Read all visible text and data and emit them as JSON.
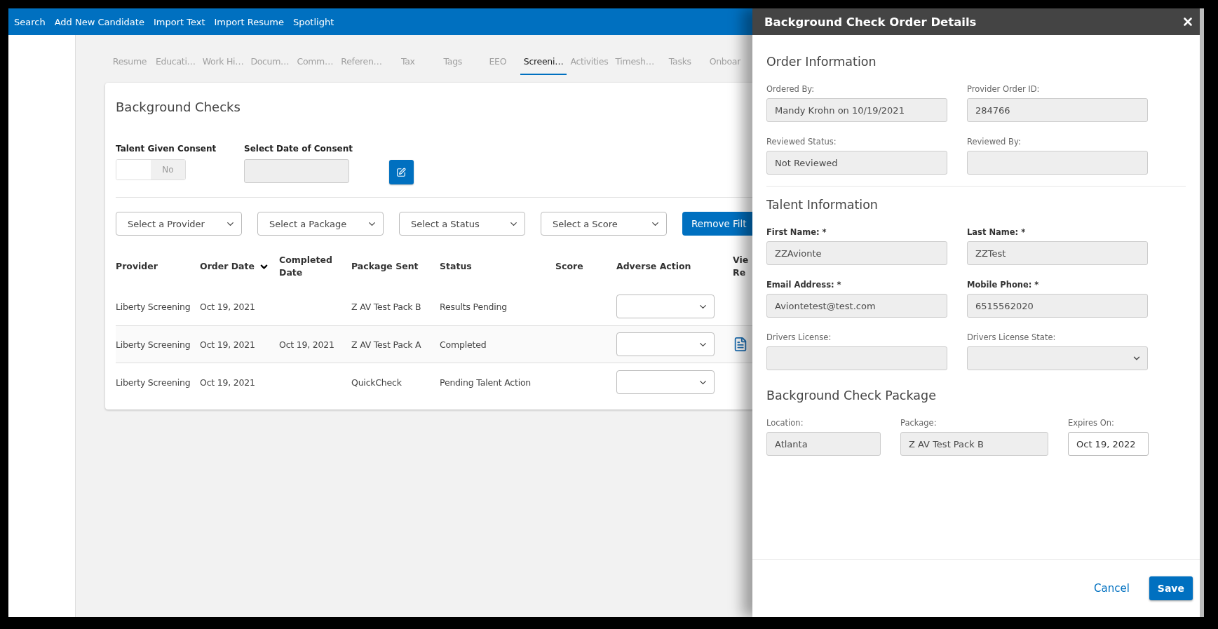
{
  "top_nav": {
    "links": [
      "Search",
      "Add New Candidate",
      "Import Text",
      "Import Resume",
      "Spotlight"
    ]
  },
  "tabs": [
    {
      "label": "Resume",
      "selected": false
    },
    {
      "label": "Educati…",
      "selected": false
    },
    {
      "label": "Work Hi…",
      "selected": false
    },
    {
      "label": "Docum…",
      "selected": false
    },
    {
      "label": "Comm…",
      "selected": false
    },
    {
      "label": "Referen…",
      "selected": false
    },
    {
      "label": "Tax",
      "selected": false
    },
    {
      "label": "Tags",
      "selected": false
    },
    {
      "label": "EEO",
      "selected": false
    },
    {
      "label": "Screeni…",
      "selected": true
    },
    {
      "label": "Activities",
      "selected": false
    },
    {
      "label": "Timesh…",
      "selected": false
    },
    {
      "label": "Tasks",
      "selected": false
    },
    {
      "label": "Onboar",
      "selected": false
    }
  ],
  "card": {
    "title": "Background Checks",
    "consent": {
      "label": "Talent Given Consent",
      "toggle_label": "No",
      "on": false
    },
    "date_of_consent": {
      "label": "Select Date of Consent"
    },
    "filters": [
      "Select a Provider",
      "Select a Package",
      "Select a Status",
      "Select a Score"
    ],
    "remove_filters_button": "Remove Filt",
    "table": {
      "columns": [
        {
          "label": "Provider",
          "sorted": false
        },
        {
          "label": "Order Date",
          "sorted": true
        },
        {
          "label": "Completed Date",
          "sorted": false
        },
        {
          "label": "Package Sent",
          "sorted": false
        },
        {
          "label": "Status",
          "sorted": false
        },
        {
          "label": "Score",
          "sorted": false
        },
        {
          "label": "Adverse Action",
          "sorted": false
        },
        {
          "label": "Vie Re",
          "sorted": false
        }
      ],
      "rows": [
        {
          "provider": "Liberty Screening",
          "order_date": "Oct 19, 2021",
          "package_sent": "Z AV Test Pack B",
          "status": "Results Pending",
          "report": false
        },
        {
          "provider": "Liberty Screening",
          "order_date": "Oct 19, 2021",
          "completed_date": "Oct 19, 2021",
          "package_sent": "Z AV Test Pack A",
          "status": "Completed",
          "report": true
        },
        {
          "provider": "Liberty Screening",
          "order_date": "Oct 19, 2021",
          "package_sent": "QuickCheck",
          "status": "Pending Talent Action",
          "report": false
        }
      ]
    }
  },
  "panel": {
    "title": "Background Check Order Details",
    "sections": [
      {
        "title": "Order Information",
        "divider": true,
        "fields": [
          {
            "label": "Ordered By:",
            "value": "Mandy Krohn on 10/19/2021",
            "kind": "text",
            "disabled": true,
            "required": false
          },
          {
            "label": "Provider Order ID:",
            "value": "284766",
            "kind": "text",
            "disabled": true,
            "required": false
          },
          {
            "label": "Reviewed Status:",
            "value": "Not Reviewed",
            "kind": "text",
            "disabled": true,
            "required": false
          },
          {
            "label": "Reviewed By:",
            "kind": "text",
            "disabled": true,
            "required": false
          }
        ]
      },
      {
        "title": "Talent Information",
        "divider": false,
        "fields": [
          {
            "label": "First Name: *",
            "value": "ZZAvionte",
            "kind": "text",
            "disabled": true,
            "required": true
          },
          {
            "label": "Last Name: *",
            "value": "ZZTest",
            "kind": "text",
            "disabled": true,
            "required": true
          },
          {
            "label": "Email Address: *",
            "value": "Aviontetest@test.com",
            "kind": "text",
            "disabled": true,
            "required": true
          },
          {
            "label": "Mobile Phone: *",
            "value": "6515562020",
            "kind": "text",
            "disabled": true,
            "required": true
          },
          {
            "label": "Drivers License:",
            "kind": "text",
            "disabled": true,
            "required": false
          },
          {
            "label": "Drivers License State:",
            "kind": "select",
            "disabled": true,
            "required": false
          }
        ]
      },
      {
        "title": "Background Check Package",
        "divider": false,
        "fields": [
          {
            "label": "Location:",
            "value": "Atlanta",
            "kind": "text",
            "disabled": true,
            "required": false
          },
          {
            "label": "Package:",
            "value": "Z AV Test Pack B",
            "kind": "text",
            "disabled": true,
            "required": false
          },
          {
            "label": "Expires On:",
            "value": "Oct 19, 2022",
            "kind": "text",
            "disabled": false,
            "required": false
          }
        ]
      }
    ],
    "cancel_link": "Cancel",
    "save_button": "Save"
  }
}
